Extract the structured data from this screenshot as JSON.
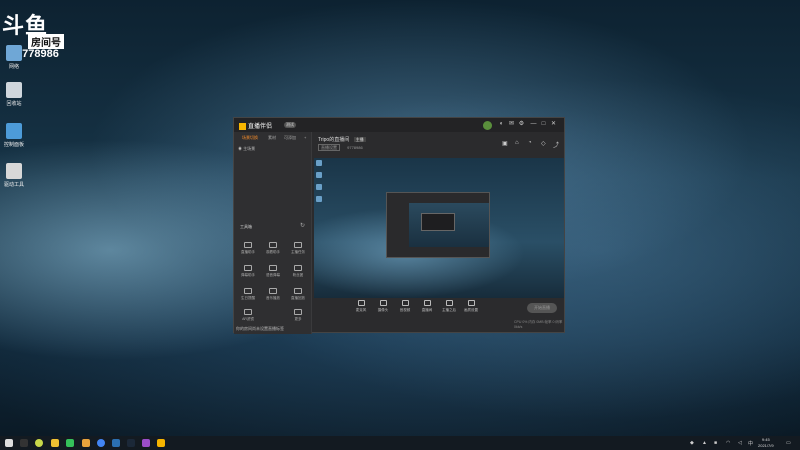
{
  "watermark": {
    "logo": "斗鱼",
    "room_label": "房间号",
    "room_number": "9778986"
  },
  "desktop": {
    "icons": [
      {
        "label": "网络"
      },
      {
        "label": "回收站"
      },
      {
        "label": "控制面板"
      },
      {
        "label": "驱动工具"
      }
    ]
  },
  "app": {
    "brand": "直播伴侣",
    "version": "测试",
    "window_buttons": [
      "—",
      "□",
      "✕"
    ],
    "sidebar": {
      "tabs": [
        "场景切换",
        "素材",
        "可添加"
      ],
      "scene_label": "主场景",
      "tools_title": "工具箱",
      "tools": [
        "直播助手",
        "观看助手",
        "主播任务",
        "弹幕助手",
        "语音弹幕",
        "粉丝团",
        "生日提醒",
        "音乐播放",
        "直播回放",
        "AR滤镜",
        "更多"
      ],
      "tip": "你的房间尚未设置直播标签"
    },
    "stream": {
      "title": "Tripo的直播间",
      "tag": "主播",
      "category": "直播设置",
      "room": "9778986"
    },
    "bottom_tools": [
      "麦克风",
      "摄像头",
      "音视频",
      "直播间",
      "主播之后",
      "画质设置"
    ],
    "start_button": "开始直播",
    "status": "CPU 0%  内存 0MB  帧率 0  码率 0kb/s"
  },
  "taskbar": {
    "clock_time": "9:45",
    "clock_date": "2021/7/9"
  },
  "colors": {
    "accent": "#f38b2a",
    "brand_yellow": "#f7b500"
  }
}
